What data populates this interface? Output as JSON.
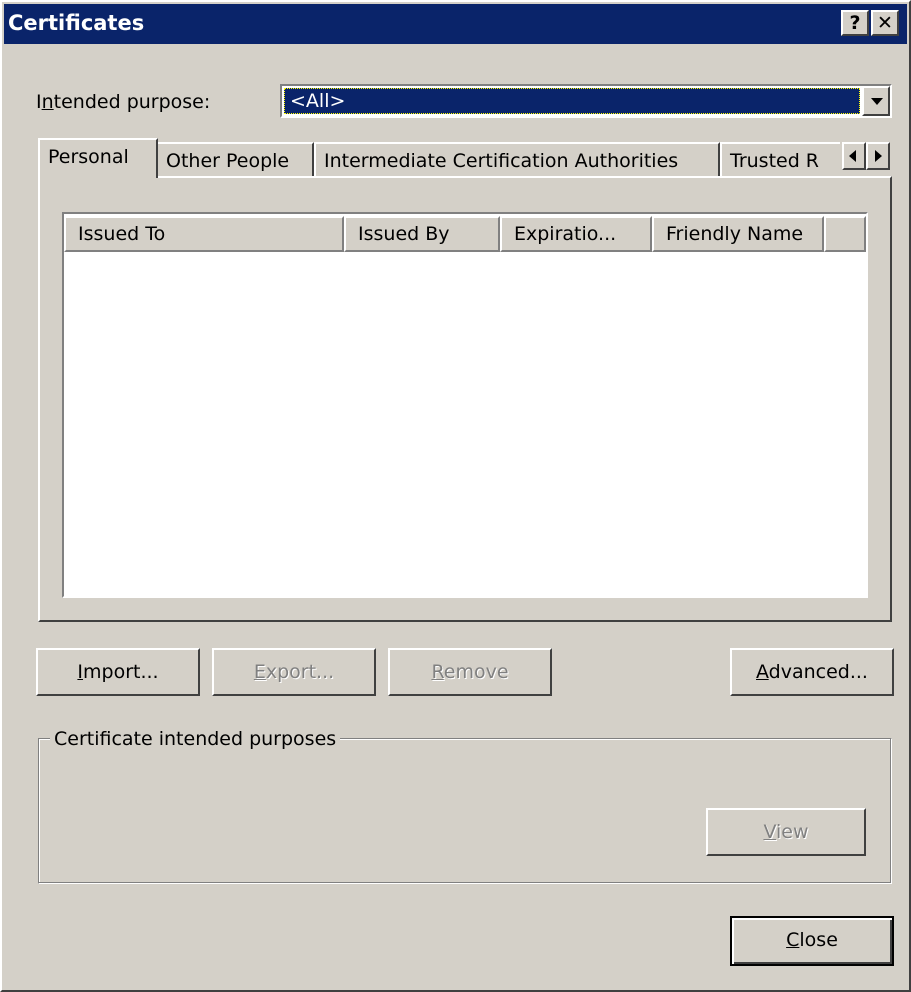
{
  "window": {
    "title": "Certificates",
    "help_button": "?",
    "close_button": "✕"
  },
  "intended_purpose": {
    "label_accel": "n",
    "label_pre": "I",
    "label_post": "tended purpose:",
    "value": "<All>"
  },
  "tabs": [
    {
      "label": "Personal",
      "active": true
    },
    {
      "label": "Other People",
      "active": false
    },
    {
      "label": "Intermediate Certification Authorities",
      "active": false
    },
    {
      "label": "Trusted R",
      "active": false
    }
  ],
  "list": {
    "columns": [
      "Issued To",
      "Issued By",
      "Expiratio...",
      "Friendly Name"
    ],
    "rows": []
  },
  "buttons": {
    "import": {
      "accel": "I",
      "rest": "mport...",
      "enabled": true
    },
    "export": {
      "accel": "E",
      "rest": "xport...",
      "enabled": false
    },
    "remove": {
      "accel": "R",
      "rest": "emove",
      "enabled": false
    },
    "advanced": {
      "accel": "A",
      "rest": "dvanced...",
      "enabled": true
    },
    "view": {
      "accel": "V",
      "rest": "iew",
      "enabled": false
    },
    "close": {
      "accel": "C",
      "rest": "lose",
      "enabled": true
    }
  },
  "purposes_group": {
    "legend": "Certificate intended purposes"
  },
  "colors": {
    "title_bar": "#0a246a",
    "face": "#d4d0c8",
    "selection": "#0a246a"
  }
}
